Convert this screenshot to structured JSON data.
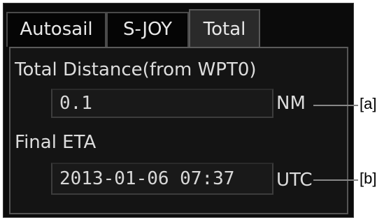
{
  "tabs": [
    {
      "label": "Autosail",
      "active": false
    },
    {
      "label": "S-JOY",
      "active": false
    },
    {
      "label": "Total",
      "active": true
    }
  ],
  "total_distance": {
    "label": "Total Distance(from WPT0)",
    "value": "0.1",
    "unit": "NM",
    "callout": "[a]"
  },
  "final_eta": {
    "label": "Final ETA",
    "value": "2013-01-06 07:37",
    "unit": "UTC",
    "callout": "[b]"
  },
  "colors": {
    "panel_background": "#0b0b0b",
    "text": "#dddddd",
    "field_background": "#191919"
  }
}
